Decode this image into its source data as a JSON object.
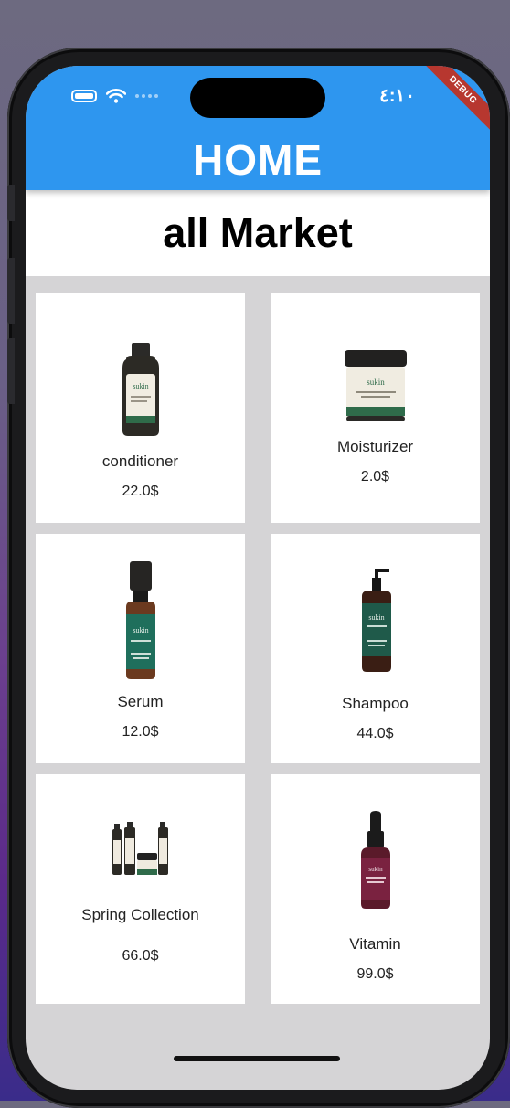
{
  "status_bar": {
    "time": "٤:١٠",
    "debug_label": "DEBUG"
  },
  "app_bar": {
    "title": "HOME"
  },
  "section": {
    "title": "all Market"
  },
  "products": [
    {
      "name": "conditioner",
      "price": "22.0$",
      "icon": "conditioner-bottle-icon"
    },
    {
      "name": "Moisturizer",
      "price": "2.0$",
      "icon": "moisturizer-jar-icon"
    },
    {
      "name": "Serum",
      "price": "12.0$",
      "icon": "serum-bottle-icon"
    },
    {
      "name": "Shampoo",
      "price": "44.0$",
      "icon": "shampoo-pump-bottle-icon"
    },
    {
      "name": "Spring Collection",
      "price": "66.0$",
      "icon": "product-collection-icon"
    },
    {
      "name": "Vitamin",
      "price": "99.0$",
      "icon": "vitamin-dropper-bottle-icon"
    }
  ],
  "colors": {
    "app_bar": "#2e96ef",
    "grid_background": "#d5d4d6",
    "card": "#ffffff",
    "debug_banner": "#b7372f"
  }
}
